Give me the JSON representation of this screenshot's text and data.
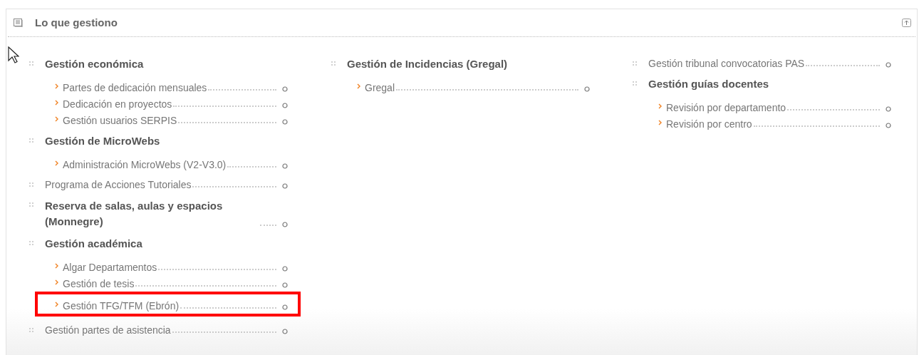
{
  "panel": {
    "title": "Lo que gestiono"
  },
  "columns": [
    {
      "entries": [
        {
          "kind": "group",
          "label": "Gestión económica",
          "children": [
            {
              "label": "Partes de dedicación mensuales",
              "highlighted": false
            },
            {
              "label": "Dedicación en proyectos",
              "highlighted": false
            },
            {
              "label": "Gestión usuarios SERPIS",
              "highlighted": false
            }
          ]
        },
        {
          "kind": "group",
          "label": "Gestión de MicroWebs",
          "children": [
            {
              "label": "Administración MicroWebs (V2-V3.0)",
              "highlighted": false
            }
          ]
        },
        {
          "kind": "link",
          "label": "Programa de Acciones Tutoriales"
        },
        {
          "kind": "bold_link",
          "label": "Reserva de salas, aulas y espacios (Monnegre)"
        },
        {
          "kind": "group",
          "label": "Gestión académica",
          "children": [
            {
              "label": "Algar Departamentos",
              "highlighted": false
            },
            {
              "label": "Gestión de tesis",
              "highlighted": false
            },
            {
              "label": "Gestión TFG/TFM (Ebrón)",
              "highlighted": true
            }
          ]
        },
        {
          "kind": "link",
          "label": "Gestión partes de asistencia"
        }
      ]
    },
    {
      "entries": [
        {
          "kind": "group",
          "label": "Gestión de Incidencias (Gregal)",
          "children": [
            {
              "label": "Gregal",
              "highlighted": false
            }
          ]
        }
      ]
    },
    {
      "entries": [
        {
          "kind": "link",
          "label": "Gestión tribunal convocatorias PAS"
        },
        {
          "kind": "group",
          "label": "Gestión guías docentes",
          "children": [
            {
              "label": "Revisión por departamento",
              "highlighted": false
            },
            {
              "label": "Revisión por centro",
              "highlighted": false
            }
          ]
        }
      ]
    }
  ]
}
